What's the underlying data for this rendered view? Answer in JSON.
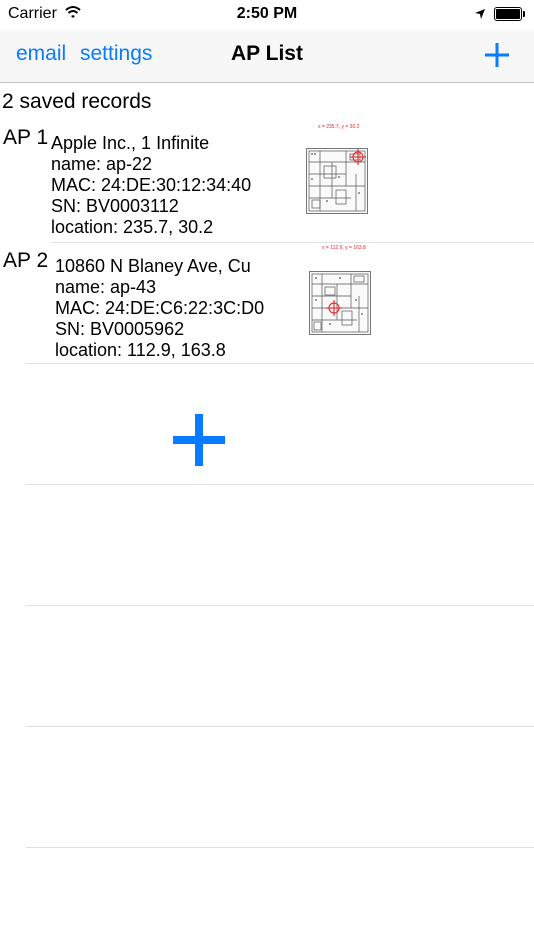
{
  "status": {
    "carrier": "Carrier",
    "time": "2:50 PM",
    "icons": [
      "wifi-icon",
      "location-arrow-icon",
      "battery-icon"
    ]
  },
  "nav": {
    "email_label": "email",
    "settings_label": "settings",
    "title": "AP List",
    "add_icon": "plus-icon"
  },
  "records_count": "2 saved records",
  "records": [
    {
      "label": "AP 1",
      "address": "Apple Inc., 1 Infinite",
      "name": "name:  ap-22",
      "mac": "MAC:  24:DE:30:12:34:40",
      "sn": "SN:   BV0003112",
      "location": "location:  235.7, 30.2",
      "map_caption": "x = 235.7, y = 30.2"
    },
    {
      "label": "AP 2",
      "address": "10860 N Blaney Ave, Cu",
      "name": "name:  ap-43",
      "mac": "MAC:  24:DE:C6:22:3C:D0",
      "sn": "SN:   BV0005962",
      "location": "location:  112.9, 163.8",
      "map_caption": "x = 112.9, y = 163.8"
    }
  ],
  "add_row_icon": "plus-icon",
  "colors": {
    "accent": "#0a7aff",
    "marker": "#e23333"
  }
}
